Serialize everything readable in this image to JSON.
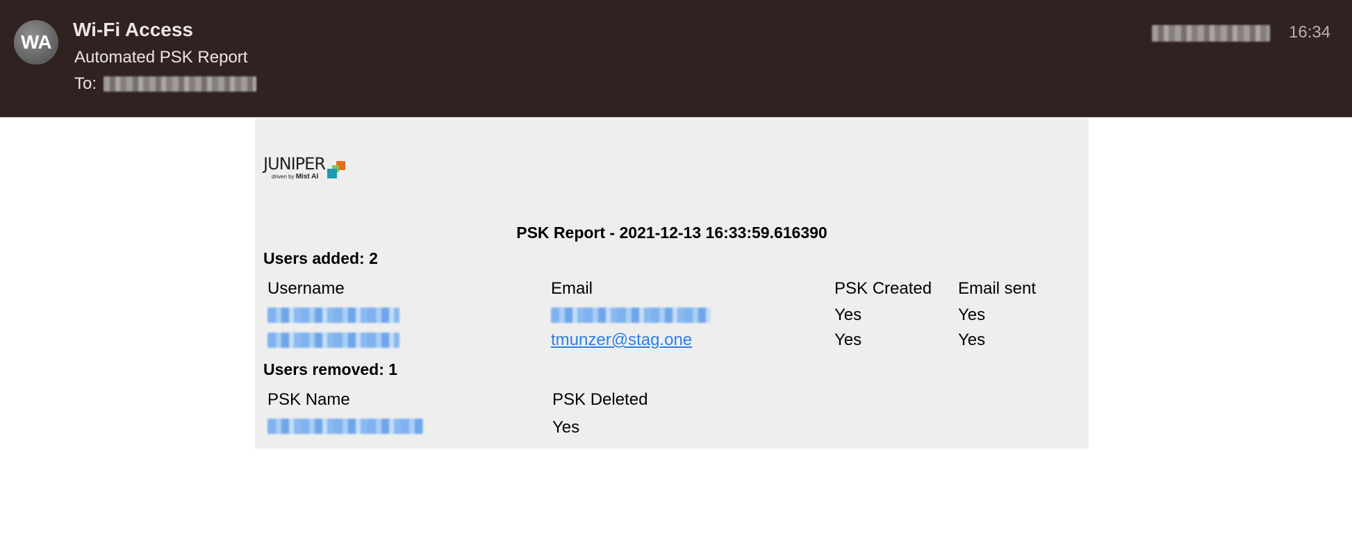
{
  "email": {
    "avatar_initials": "WA",
    "sender": "Wi-Fi Access",
    "subject": "Automated PSK Report",
    "to_label": "To:",
    "time": "16:34"
  },
  "report": {
    "logo_word": "JUNIPER",
    "logo_tagline_prefix": "driven by",
    "logo_tagline_brand": "Mist AI",
    "title": "PSK Report - 2021-12-13 16:33:59.616390",
    "added": {
      "heading": "Users added: 2",
      "columns": [
        "Username",
        "Email",
        "PSK Created",
        "Email sent"
      ],
      "rows": [
        {
          "email": "",
          "psk_created": "Yes",
          "email_sent": "Yes"
        },
        {
          "email": "tmunzer@stag.one",
          "psk_created": "Yes",
          "email_sent": "Yes"
        }
      ]
    },
    "removed": {
      "heading": "Users removed: 1",
      "columns": [
        "PSK Name",
        "PSK Deleted"
      ],
      "rows": [
        {
          "psk_deleted": "Yes"
        }
      ]
    }
  },
  "colors": {
    "header_bg": "#302220",
    "content_bg": "#eeeeee",
    "link": "#2c7fe6"
  }
}
